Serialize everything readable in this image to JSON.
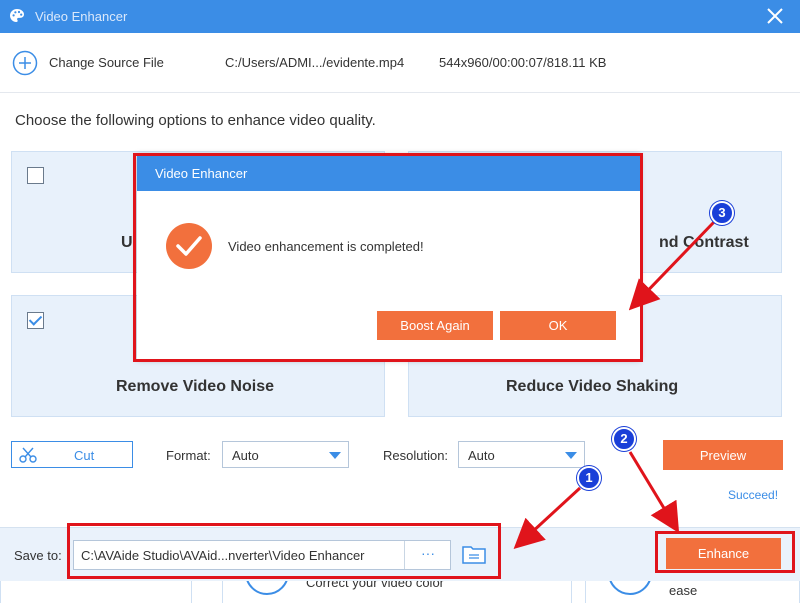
{
  "window": {
    "title": "Video Enhancer",
    "accent_color": "#3b8de6",
    "action_color": "#f2703d"
  },
  "source": {
    "change_label": "Change Source File",
    "path": "C:/Users/ADMI.../evidente.mp4",
    "meta": "544x960/00:00:07/818.11 KB"
  },
  "instruction": "Choose the following options to enhance video quality.",
  "options": [
    {
      "label_visible": "U",
      "checked": false
    },
    {
      "label_visible": "nd Contrast",
      "checked": false
    },
    {
      "label": "Remove Video Noise",
      "checked": true
    },
    {
      "label": "Reduce Video Shaking",
      "checked": false
    }
  ],
  "controls": {
    "cut_label": "Cut",
    "format_label": "Format:",
    "format_value": "Auto",
    "resolution_label": "Resolution:",
    "resolution_value": "Auto",
    "preview_label": "Preview",
    "status": "Succeed!",
    "enhance_label": "Enhance"
  },
  "save": {
    "label": "Save to:",
    "path": "C:\\AVAide Studio\\AVAid...nverter\\Video Enhancer",
    "browse": "···"
  },
  "background_cards": {
    "middle_text": "Correct your video color",
    "right_text": "ease"
  },
  "dialog": {
    "title": "Video Enhancer",
    "message": "Video enhancement is completed!",
    "boost_again": "Boost Again",
    "ok": "OK"
  },
  "annotations": {
    "markers": [
      "1",
      "2",
      "3"
    ],
    "highlight_color": "#e0141b",
    "marker_color": "#1a3fd8"
  }
}
